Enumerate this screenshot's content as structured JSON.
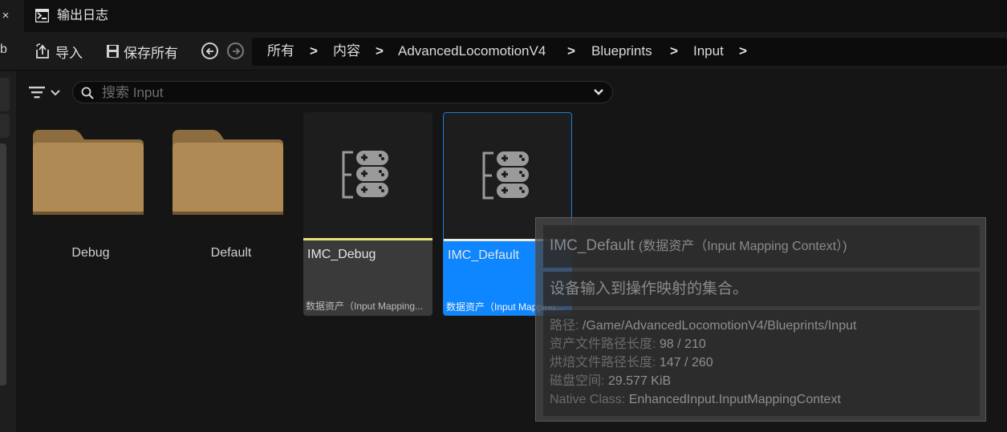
{
  "tabs": {
    "close_glyph": "×",
    "active_label": "输出日志"
  },
  "toolbar": {
    "left_letter": "b",
    "import_label": "导入",
    "save_all_label": "保存所有"
  },
  "breadcrumb": {
    "separator": ">",
    "items": [
      "所有",
      "内容",
      "AdvancedLocomotionV4",
      "Blueprints",
      "Input"
    ]
  },
  "search": {
    "placeholder": "搜索 Input"
  },
  "folders": [
    {
      "label": "Debug"
    },
    {
      "label": "Default"
    }
  ],
  "assets": [
    {
      "name": "IMC_Debug",
      "type": "数据资产（Input Mapping...",
      "strip_color": "#e8e27a",
      "selected": false
    },
    {
      "name": "IMC_Default",
      "type": "数据资产（Input Mapping...",
      "strip_color": "#f0ece0",
      "selected": true
    }
  ],
  "tooltip": {
    "title": "IMC_Default",
    "title_sub": "(数据资产（Input Mapping Context）)",
    "description": "设备输入到操作映射的集合。",
    "path_key": "路径:",
    "path_value": "/Game/AdvancedLocomotionV4/Blueprints/Input",
    "asset_len_key": "资产文件路径长度:",
    "asset_len_value": "98 / 210",
    "cooked_len_key": "烘焙文件路径长度:",
    "cooked_len_value": "147 / 260",
    "disk_key": "磁盘空间:",
    "disk_value": "29.577 KiB",
    "class_key": "Native Class:",
    "class_value": "EnhancedInput.InputMappingContext"
  },
  "colors": {
    "selection_blue": "#0e86ff",
    "folder_tan": "#b08a55",
    "debug_strip": "#e8e27a"
  }
}
